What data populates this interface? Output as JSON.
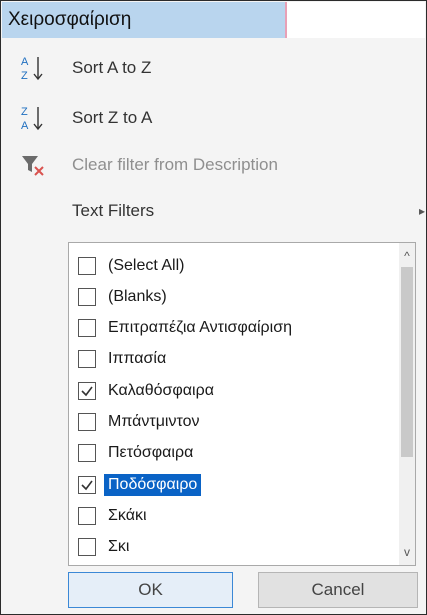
{
  "header": {
    "column_title": "Χειροσφαίριση"
  },
  "menu": {
    "sort_az": "Sort A to Z",
    "sort_za": "Sort Z to A",
    "clear_filter": "Clear filter from Description",
    "text_filters": "Text Filters",
    "submenu_arrow": "▸"
  },
  "list": {
    "items": [
      {
        "label": "(Select All)",
        "checked": false
      },
      {
        "label": "(Blanks)",
        "checked": false
      },
      {
        "label": "Επιτραπέζια Αντισφαίριση",
        "checked": false
      },
      {
        "label": "Ιππασία",
        "checked": false
      },
      {
        "label": "Καλαθόσφαιρα",
        "checked": true
      },
      {
        "label": "Μπάντμιντον",
        "checked": false
      },
      {
        "label": "Πετόσφαιρα",
        "checked": false
      },
      {
        "label": "Ποδόσφαιρο",
        "checked": true,
        "selected": true
      },
      {
        "label": "Σκάκι",
        "checked": false
      },
      {
        "label": "Σκι",
        "checked": false
      }
    ],
    "scroll_up": "^",
    "scroll_down": "v"
  },
  "buttons": {
    "ok": "OK",
    "cancel": "Cancel"
  },
  "colors": {
    "header_bg": "#b9d5ee",
    "selection_bg": "#0a63c6",
    "ok_border": "#3b88d6"
  }
}
